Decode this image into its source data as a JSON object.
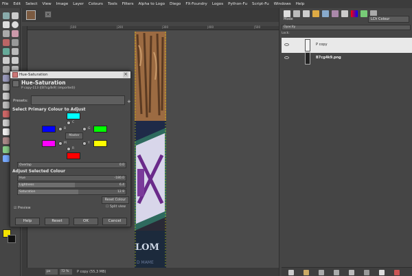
{
  "menu": [
    "File",
    "Edit",
    "Select",
    "View",
    "Image",
    "Layer",
    "Colours",
    "Tools",
    "Filters",
    "Alpha to Logo",
    "Diego",
    "FX-Foundry",
    "Logos",
    "Python-Fu",
    "Script-Fu",
    "Windows",
    "Help"
  ],
  "toolbox": {
    "fg_color": "#f5e400",
    "bg_color": "#111111"
  },
  "image_tab": {
    "close": "×"
  },
  "ruler": {
    "ticks": [
      "|100",
      "|200",
      "|300",
      "|400",
      "|500"
    ]
  },
  "status": {
    "unit": "px",
    "zoom": "72 %",
    "layer_info": "P copy (55,3 MB)"
  },
  "layers_panel": {
    "mode_label": "Mode",
    "mode_value": "LCh Colour",
    "opacity_label": "Opacity",
    "lock_label": "Lock:",
    "layers": [
      {
        "name": "P copy",
        "selected": true
      },
      {
        "name": "B7cg4k9.png",
        "selected": false
      }
    ]
  },
  "dialog": {
    "window_title": "Hue-Saturation",
    "heading": "Hue-Saturation",
    "subtitle": "P copy-113 ([B7cg4k9] (imported))",
    "presets_label": "Presets:",
    "presets_add": "+",
    "primary_heading": "Select Primary Colour to Adjust",
    "primaries": [
      {
        "key": "R",
        "color": "#ff0000"
      },
      {
        "key": "Y",
        "color": "#ffff00"
      },
      {
        "key": "G",
        "color": "#00ff00"
      },
      {
        "key": "C",
        "color": "#00ffff"
      },
      {
        "key": "B",
        "color": "#0000ff"
      },
      {
        "key": "M",
        "color": "#ff00ff"
      }
    ],
    "master_label": "Master",
    "overlap": {
      "label": "Overlap",
      "value": "0.0"
    },
    "adjust_heading": "Adjust Selected Colour",
    "hue": {
      "label": "Hue",
      "value": "-180.0",
      "fraction": 0.0
    },
    "lightness": {
      "label": "Lightness",
      "value": "6.4",
      "fraction": 0.53
    },
    "saturation": {
      "label": "Saturation",
      "value": "12.9",
      "fraction": 0.56
    },
    "reset_colour": "Reset Colour",
    "preview_label": "Preview",
    "split_view_label": "Split view",
    "buttons": {
      "help": "Help",
      "reset": "Reset",
      "ok": "OK",
      "cancel": "Cancel"
    }
  }
}
